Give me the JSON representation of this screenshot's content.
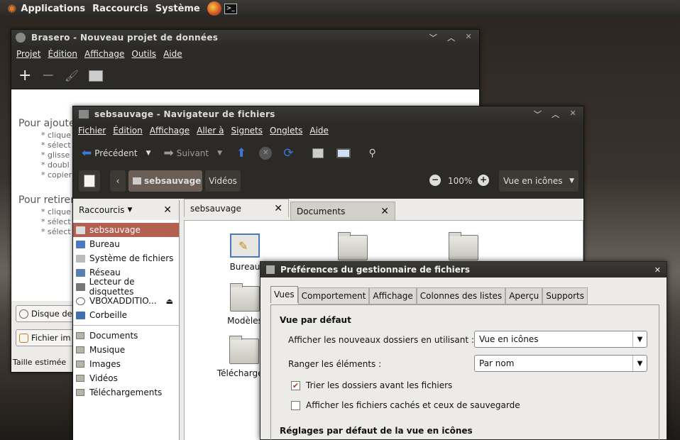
{
  "panel": {
    "applications": "Applications",
    "shortcuts": "Raccourcis",
    "system": "Système"
  },
  "brasero": {
    "title": "Brasero - Nouveau projet de données",
    "menu": [
      "Projet",
      "Édition",
      "Affichage",
      "Outils",
      "Aide"
    ],
    "add_heading": "Pour ajoute",
    "add_items": [
      "* clique",
      "* sélect",
      "* glisse",
      "* doubl",
      "* copier"
    ],
    "remove_heading": "Pour retirer",
    "remove_items": [
      "* clique",
      "* sélect",
      "* sélect"
    ],
    "disk_label": "Disque de",
    "file_label": "Fichier im",
    "size_label": "Taille estimée"
  },
  "nautilus": {
    "title": "sebsauvage - Navigateur de fichiers",
    "menu": [
      "Fichier",
      "Édition",
      "Affichage",
      "Aller à",
      "Signets",
      "Onglets",
      "Aide"
    ],
    "back": "Précédent",
    "forward": "Suivant",
    "path_current": "sebsauvage",
    "path_next": "Vidéos",
    "zoom": "100%",
    "view_mode": "Vue en icônes",
    "sidebar_header": "Raccourcis",
    "places": [
      "sebsauvage",
      "Bureau",
      "Système de fichiers",
      "Réseau",
      "Lecteur de disquettes",
      "VBOXADDITIO...",
      "Corbeille"
    ],
    "bookmarks": [
      "Documents",
      "Musique",
      "Images",
      "Vidéos",
      "Téléchargements"
    ],
    "tabs": [
      "sebsauvage",
      "Documents"
    ],
    "icons": [
      "Bureau",
      "Modèles",
      "Téléchargem"
    ]
  },
  "prefs": {
    "title": "Préférences du gestionnaire de fichiers",
    "tabs": [
      "Vues",
      "Comportement",
      "Affichage",
      "Colonnes des listes",
      "Aperçu",
      "Supports"
    ],
    "section1": "Vue par défaut",
    "label_new_folders": "Afficher les nouveaux dossiers en utilisant :",
    "value_new_folders": "Vue en icônes",
    "label_arrange": "Ranger les éléments :",
    "value_arrange": "Par nom",
    "check_folders_first": "Trier les dossiers avant les fichiers",
    "check_hidden": "Afficher les fichiers cachés et ceux de sauvegarde",
    "section2": "Réglages par défaut de la vue en icônes"
  },
  "colors": {
    "accent": "#c97a5a",
    "selected": "#b36050",
    "dark_panel": "#2c2a27"
  }
}
